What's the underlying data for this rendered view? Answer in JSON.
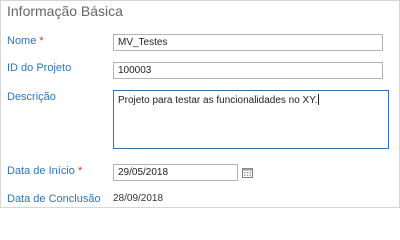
{
  "section": {
    "title": "Informação Básica"
  },
  "fields": {
    "nome": {
      "label": "Nome",
      "required_marker": "*",
      "value": "MV_Testes"
    },
    "id_projeto": {
      "label": "ID do Projeto",
      "value": "100003"
    },
    "descricao": {
      "label": "Descrição",
      "value": "Projeto para testar as funcionalidades no XY."
    },
    "data_inicio": {
      "label": "Data de Início",
      "required_marker": "*",
      "value": "29/05/2018"
    },
    "data_conclusao": {
      "label": "Data de Conclusão",
      "value": "28/09/2018"
    }
  },
  "colors": {
    "label": "#2e75b6",
    "required": "#c0392b",
    "focus_border": "#2e75b6"
  },
  "icons": {
    "date_picker": "calendar-icon"
  }
}
